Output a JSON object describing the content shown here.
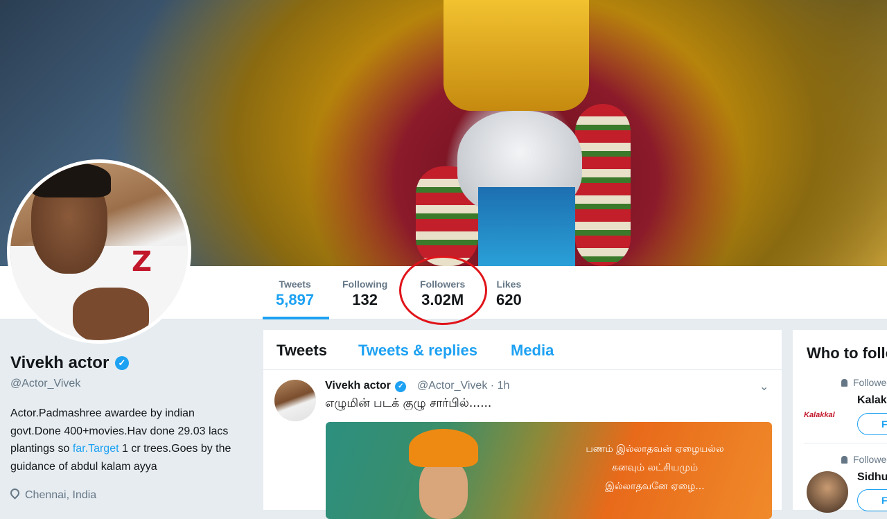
{
  "profile": {
    "name": "Vivekh actor",
    "handle": "@Actor_Vivek",
    "bio_before_link": "Actor.Padmashree awardee by indian govt.Done 400+movies.Hav done 29.03 lacs plantings so ",
    "bio_link": "far.Target",
    "bio_after_link": " 1 cr trees.Goes by the guidance of abdul kalam ayya",
    "location": "Chennai, India",
    "verified_glyph": "✓"
  },
  "nav": {
    "stats": [
      {
        "label": "Tweets",
        "value": "5,897"
      },
      {
        "label": "Following",
        "value": "132"
      },
      {
        "label": "Followers",
        "value": "3.02M"
      },
      {
        "label": "Likes",
        "value": "620"
      }
    ]
  },
  "timeline": {
    "tabs": [
      {
        "label": "Tweets"
      },
      {
        "label": "Tweets & replies"
      },
      {
        "label": "Media"
      }
    ],
    "tweet": {
      "name": "Vivekh actor",
      "handle": "@Actor_Vivek",
      "separator": "·",
      "time": "1h",
      "text": "எழுமின் படக் குழு சார்பில்......",
      "image_quote_lines": [
        "பணம் இல்லாதவன் ஏழையல்ல",
        "கனவும் லட்சியமும்",
        "இல்லாதவனே ஏழை..."
      ],
      "caret": "⌄"
    }
  },
  "who_to_follow": {
    "title": "Who to follow",
    "items": [
      {
        "follows_text": "Followed by",
        "name": "Kalakkal",
        "button": "Follow",
        "logo_text": "Kalakkal"
      },
      {
        "follows_text": "Followed by",
        "name": "Sidhu",
        "button": "Follow"
      }
    ]
  },
  "colors": {
    "accent": "#1da1f2",
    "highlight_circle": "#e0141a"
  }
}
